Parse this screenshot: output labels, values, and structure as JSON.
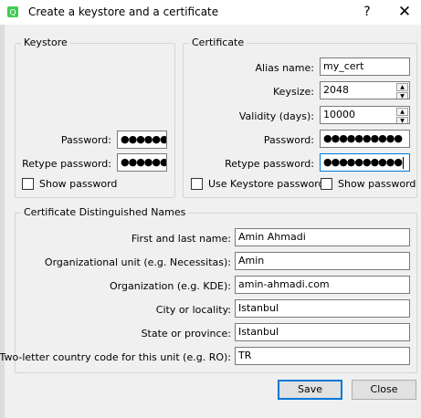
{
  "window": {
    "title": "Create a keystore and a certificate",
    "help_label": "?",
    "close_label": "✕"
  },
  "keystore": {
    "group_title": "Keystore",
    "password_label": "Password:",
    "password_value": "●●●●●●●",
    "retype_label": "Retype password:",
    "retype_value": "●●●●●●●",
    "show_password_label": "Show password"
  },
  "certificate": {
    "group_title": "Certificate",
    "alias_label": "Alias name:",
    "alias_value": "my_cert",
    "keysize_label": "Keysize:",
    "keysize_value": "2048",
    "validity_label": "Validity (days):",
    "validity_value": "10000",
    "password_label": "Password:",
    "password_value": "●●●●●●●●●●",
    "retype_label": "Retype password:",
    "retype_value": "●●●●●●●●●●",
    "use_keystore_label": "Use Keystore password",
    "show_password_label": "Show password"
  },
  "dn": {
    "group_title": "Certificate Distinguished Names",
    "fields": [
      {
        "label": "First and last name:",
        "value": "Amin Ahmadi"
      },
      {
        "label": "Organizational unit (e.g. Necessitas):",
        "value": "Amin"
      },
      {
        "label": "Organization (e.g. KDE):",
        "value": "amin-ahmadi.com"
      },
      {
        "label": "City or locality:",
        "value": "Istanbul"
      },
      {
        "label": "State or province:",
        "value": "Istanbul"
      },
      {
        "label": "Two-letter country code for this unit (e.g. RO):",
        "value": "TR"
      }
    ]
  },
  "buttons": {
    "save": "Save",
    "close": "Close"
  }
}
